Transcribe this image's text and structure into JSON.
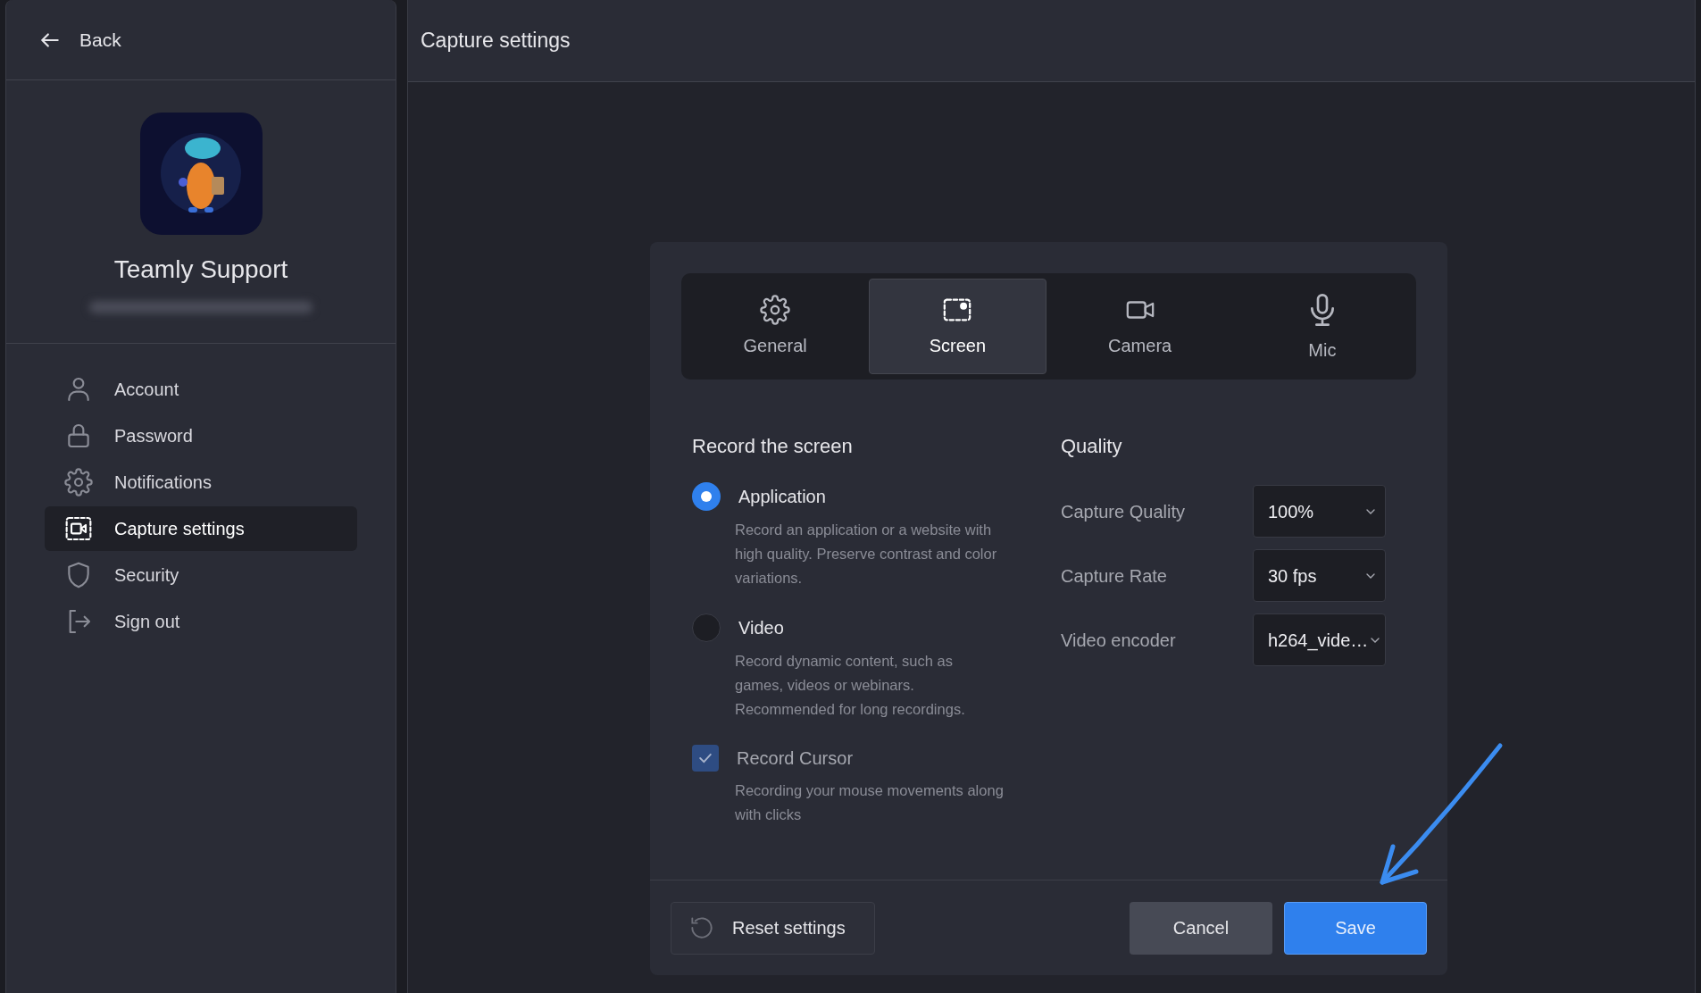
{
  "sidebar": {
    "back": "Back",
    "profile": {
      "name": "Teamly Support"
    },
    "items": [
      {
        "label": "Account",
        "selected": false
      },
      {
        "label": "Password",
        "selected": false
      },
      {
        "label": "Notifications",
        "selected": false
      },
      {
        "label": "Capture settings",
        "selected": true
      },
      {
        "label": "Security",
        "selected": false
      },
      {
        "label": "Sign out",
        "selected": false
      }
    ]
  },
  "header": {
    "title": "Capture settings"
  },
  "dialog": {
    "tabs": [
      {
        "label": "General",
        "selected": false
      },
      {
        "label": "Screen",
        "selected": true
      },
      {
        "label": "Camera",
        "selected": false
      },
      {
        "label": "Mic",
        "selected": false
      }
    ],
    "record": {
      "title": "Record the screen",
      "options": [
        {
          "kind": "radio",
          "label": "Application",
          "description": "Record an application or a website with high quality. Preserve contrast and color variations.",
          "selected": true
        },
        {
          "kind": "radio",
          "label": "Video",
          "description": "Record dynamic content, such as games, videos or webinars. Recommended for long recordings.",
          "selected": false
        },
        {
          "kind": "checkbox",
          "label": "Record Cursor",
          "description": "Recording your mouse movements along with clicks",
          "checked": true
        }
      ]
    },
    "quality": {
      "title": "Quality",
      "fields": [
        {
          "label": "Capture Quality",
          "value": "100%"
        },
        {
          "label": "Capture Rate",
          "value": "30 fps"
        },
        {
          "label": "Video encoder",
          "value": "h264_vide…"
        }
      ]
    },
    "buttons": {
      "reset": "Reset settings",
      "cancel": "Cancel",
      "save": "Save"
    }
  }
}
